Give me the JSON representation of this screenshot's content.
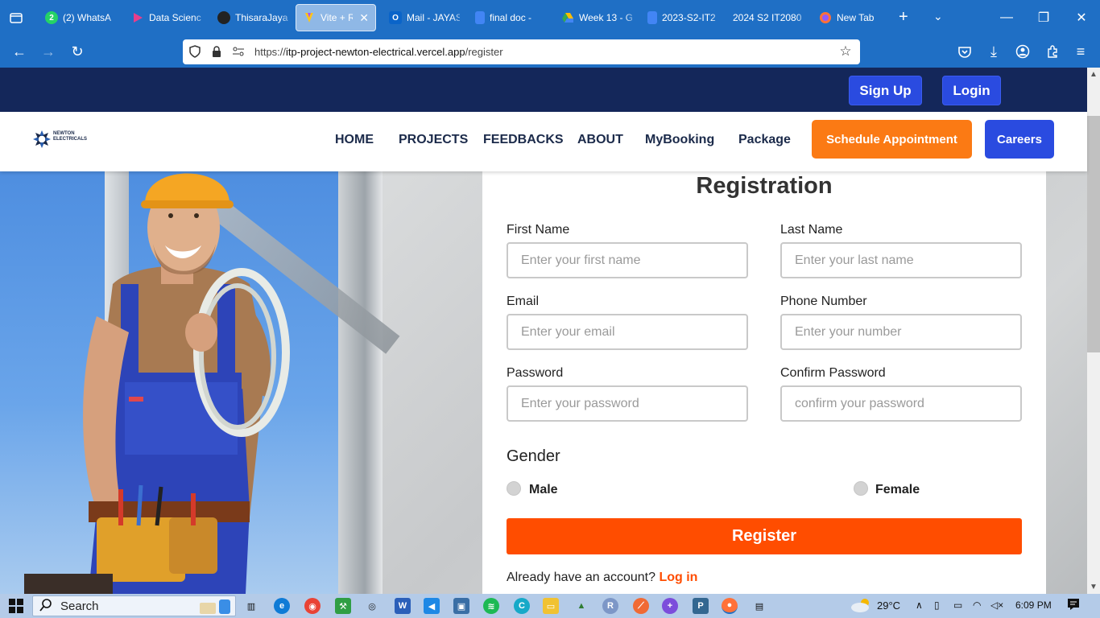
{
  "browser": {
    "tabs": [
      {
        "title": "(2) WhatsA",
        "favicon": "whatsapp-icon",
        "badge": "2"
      },
      {
        "title": "Data Scienc",
        "favicon": "play-icon"
      },
      {
        "title": "ThisaraJayas",
        "favicon": "github-icon"
      },
      {
        "title": "Vite + Re",
        "favicon": "vite-icon",
        "active": true
      },
      {
        "title": "Mail - JAYAS",
        "favicon": "outlook-icon"
      },
      {
        "title": "final doc -",
        "favicon": "docs-icon"
      },
      {
        "title": "Week 13 - G",
        "favicon": "drive-icon"
      },
      {
        "title": "2023-S2-IT2",
        "favicon": "docs-icon"
      },
      {
        "title": "2024 S2 IT2080 I",
        "favicon": "none"
      },
      {
        "title": "New Tab",
        "favicon": "firefox-icon"
      }
    ],
    "url_prefix": "https://",
    "url_domain": "itp-project-newton-electrical.vercel.app",
    "url_path": "/register"
  },
  "site": {
    "top_buttons": {
      "signup": "Sign Up",
      "login": "Login"
    },
    "logo": {
      "line1": "NEWTON",
      "line2": "ELECTRICALS"
    },
    "menu": [
      "HOME",
      "PROJECTS",
      "FEEDBACKS",
      "ABOUT",
      "MyBooking",
      "Package"
    ],
    "schedule_btn": "Schedule Appointment",
    "careers_btn": "Careers",
    "colors": {
      "navy": "#14275a",
      "blue": "#2a4be0",
      "orange": "#ff4d00",
      "cta_orange": "#fb7a14"
    }
  },
  "form": {
    "title": "Registration",
    "first_name": {
      "label": "First Name",
      "placeholder": "Enter your first name"
    },
    "last_name": {
      "label": "Last Name",
      "placeholder": "Enter your last name"
    },
    "email": {
      "label": "Email",
      "placeholder": "Enter your email"
    },
    "phone": {
      "label": "Phone Number",
      "placeholder": "Enter your number"
    },
    "password": {
      "label": "Password",
      "placeholder": "Enter your password"
    },
    "confirm": {
      "label": "Confirm Password",
      "placeholder": "confirm your password"
    },
    "gender_label": "Gender",
    "gender_male": "Male",
    "gender_female": "Female",
    "register_btn": "Register",
    "login_prompt": "Already have an account?",
    "login_link": "Log in"
  },
  "taskbar": {
    "search": "Search",
    "weather": "29°C",
    "time": "6:09 PM"
  }
}
